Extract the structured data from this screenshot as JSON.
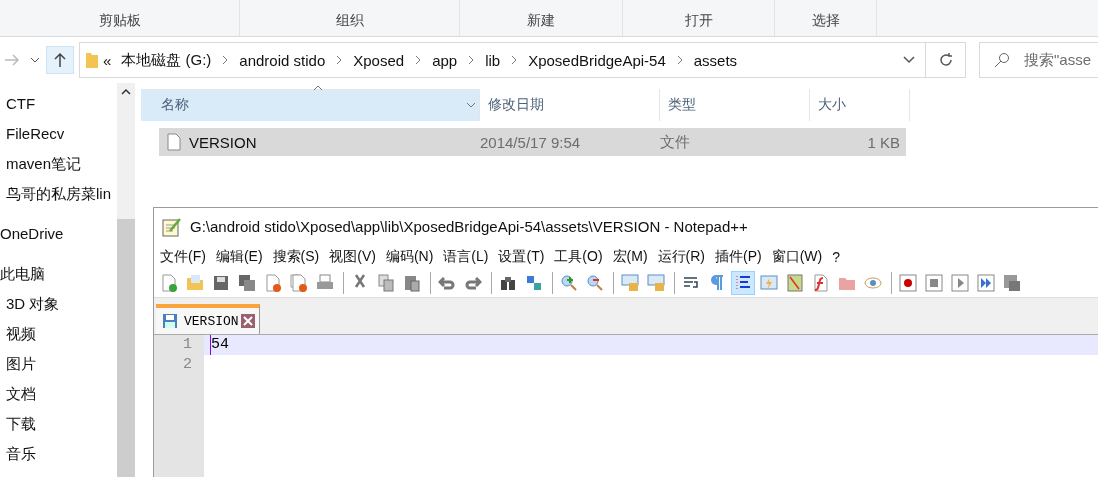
{
  "ribbon_groups": [
    "剪贴板",
    "组织",
    "新建",
    "打开",
    "选择"
  ],
  "address_bar": {
    "overflow": "«",
    "crumbs": [
      "本地磁盘 (G:)",
      "android stido",
      "Xposed",
      "app",
      "lib",
      "XposedBridgeApi-54",
      "assets"
    ]
  },
  "search": {
    "placeholder": "搜索\"asse"
  },
  "quick_access": [
    "CTF",
    "FileRecv",
    "maven笔记",
    "鸟哥的私房菜lin"
  ],
  "roots": [
    {
      "label": "OneDrive"
    },
    {
      "label": "此电脑",
      "children": [
        "3D 对象",
        "视频",
        "图片",
        "文档",
        "下载",
        "音乐"
      ]
    }
  ],
  "columns": [
    {
      "label": "名称",
      "sorted": true
    },
    {
      "label": "修改日期",
      "sorted": false
    },
    {
      "label": "类型",
      "sorted": false
    },
    {
      "label": "大小",
      "sorted": false
    }
  ],
  "files": [
    {
      "name": "VERSION",
      "modified": "2014/5/17 9:54",
      "type": "文件",
      "size": "1 KB",
      "selected": true
    }
  ],
  "notepad": {
    "title": "G:\\android stido\\Xposed\\app\\lib\\XposedBridgeApi-54\\assets\\VERSION - Notepad++",
    "menu": [
      "文件(F)",
      "编辑(E)",
      "搜索(S)",
      "视图(V)",
      "编码(N)",
      "语言(L)",
      "设置(T)",
      "工具(O)",
      "宏(M)",
      "运行(R)",
      "插件(P)",
      "窗口(W)",
      "?"
    ],
    "toolbar": [
      {
        "selected": false
      },
      {
        "selected": false
      },
      {
        "selected": false
      },
      {
        "selected": false
      },
      {
        "selected": false
      },
      {
        "selected": false
      },
      {
        "selected": false
      },
      {
        "selected": false
      },
      {
        "selected": false
      },
      {
        "selected": false
      },
      {
        "selected": false
      },
      {
        "selected": false
      },
      {
        "selected": false
      },
      {
        "selected": false
      },
      {
        "selected": false
      },
      {
        "selected": false
      },
      {
        "selected": false
      },
      {
        "selected": false
      },
      {
        "selected": false
      },
      {
        "selected": false
      },
      {
        "selected": true
      },
      {
        "selected": false
      },
      {
        "selected": false
      },
      {
        "selected": false
      },
      {
        "selected": false
      },
      {
        "selected": false
      },
      {
        "selected": false
      },
      {
        "selected": false
      },
      {
        "selected": false
      },
      {
        "selected": false
      },
      {
        "selected": false
      }
    ],
    "tabs": [
      {
        "label": "VERSION",
        "selected": true
      }
    ],
    "lines": [
      {
        "number": "1",
        "text": "54",
        "current": true
      },
      {
        "number": "2",
        "current": false
      }
    ]
  }
}
